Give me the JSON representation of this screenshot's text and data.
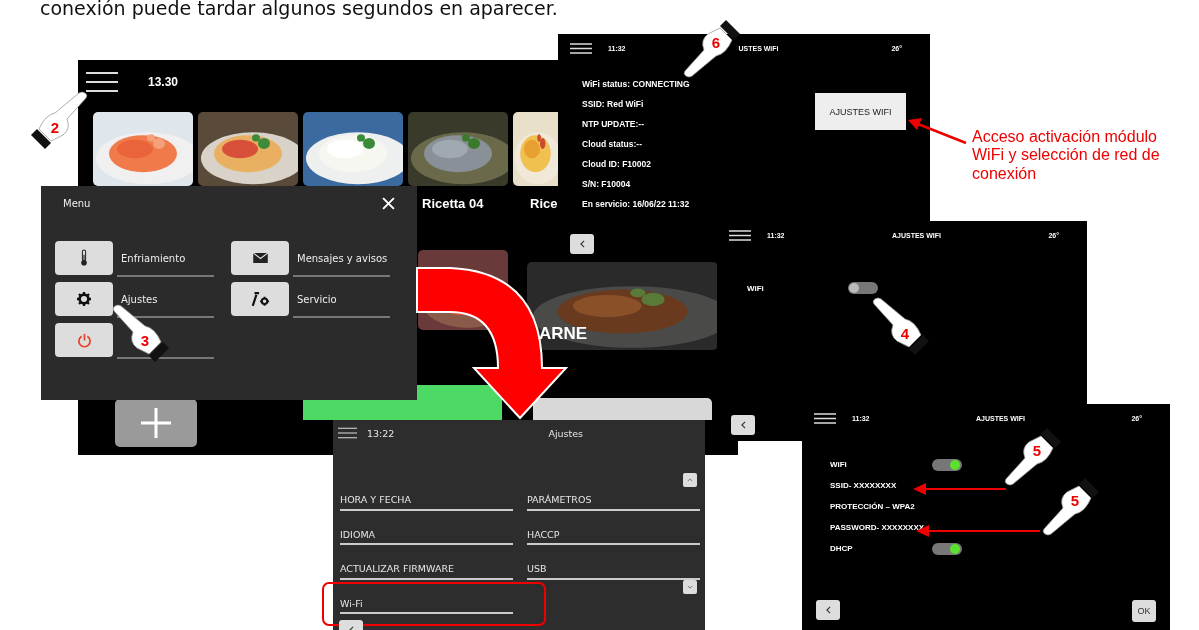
{
  "caption": "conexión puede tardar algunos segundos en aparecer.",
  "home_screen": {
    "time": "13.30",
    "recipe_labels": [
      "Ricetta 04",
      "Rice"
    ],
    "category_label": "ARNE"
  },
  "menu": {
    "title": "Menu",
    "items": [
      {
        "kind": "cooling",
        "label": "Enfriamiento"
      },
      {
        "kind": "messages",
        "label": "Mensajes y avisos"
      },
      {
        "kind": "settings",
        "label": "Ajustes"
      },
      {
        "kind": "service",
        "label": "Servicio"
      },
      {
        "kind": "power"
      }
    ]
  },
  "wifi_status_screen": {
    "time": "11:32",
    "title": "USTES WiFi",
    "temperature": "26°",
    "status_lines": [
      "WiFi status: CONNECTING",
      "SSID: Red WiFi",
      "NTP UPDATE:--",
      "Cloud status:--",
      "Cloud ID: F10002",
      "S/N: F10004",
      "En servicio: 16/06/22 11:32"
    ],
    "button": "AJUSTES WIFI"
  },
  "annotation": "Acceso activación módulo WiFi y selección de red de conexión",
  "wifi_toggle_screen": {
    "time": "11:32",
    "title": "AJUSTES WIFI",
    "temperature": "26°",
    "wifi_label": "WiFi",
    "wifi_on": false
  },
  "wifi_settings_screen": {
    "time": "11:32",
    "title": "AJUSTES WIFI",
    "temperature": "26°",
    "rows": [
      {
        "kind": "toggle",
        "label": "WiFi",
        "on": true
      },
      {
        "kind": "text",
        "label": "SSID- XXXXXXXX"
      },
      {
        "kind": "text",
        "label": "PROTECCIÓN – WPA2"
      },
      {
        "kind": "text",
        "label": "PASSWORD- XXXXXXXX"
      },
      {
        "kind": "toggle",
        "label": "DHCP",
        "on": true
      }
    ],
    "ok_button": "OK"
  },
  "settings_screen": {
    "time": "13:22",
    "title": "Ajustes",
    "items": [
      {
        "label": "HORA Y FECHA",
        "selected": false
      },
      {
        "label": "PARÁMETROS",
        "selected": false
      },
      {
        "label": "IDIOMA",
        "selected": false
      },
      {
        "label": "HACCP",
        "selected": false
      },
      {
        "label": "ACTUALIZAR FIRMWARE",
        "selected": false
      },
      {
        "label": "USB",
        "selected": false
      },
      {
        "label": "Wi-Fi",
        "selected": true
      }
    ]
  },
  "steps": [
    "2",
    "3",
    "6",
    "4",
    "5",
    "5"
  ]
}
